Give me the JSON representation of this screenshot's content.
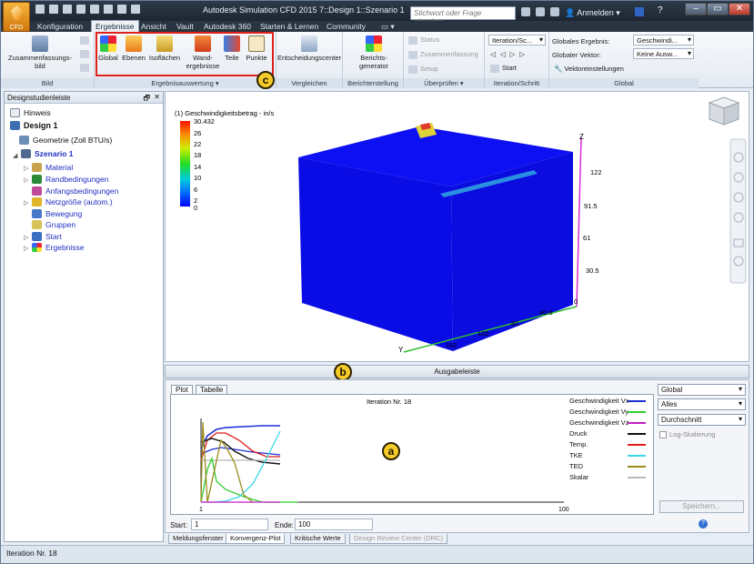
{
  "titlebar": {
    "app_label": "CFD",
    "title": "Autodesk Simulation CFD 2015   7::Design 1::Szenario 1",
    "search_placeholder": "Stichwort oder Frage eingeben",
    "signin": "Anmelden",
    "help": "?"
  },
  "tabs": [
    "Konfiguration",
    "Ergebnisse",
    "Ansicht",
    "Vault",
    "Autodesk 360",
    "Starten & Lernen",
    "Community"
  ],
  "active_tab": "Ergebnisse",
  "ribbon": {
    "bild": {
      "button": "Zusammenfassungs-bild",
      "footer": "Bild"
    },
    "ergebnisauswertung": {
      "buttons": [
        "Global",
        "Ebenen",
        "Isoflächen",
        "Wand-ergebnisse",
        "Teile",
        "Punkte"
      ],
      "footer": "Ergebnisauswertung"
    },
    "vergleichen": {
      "button": "Entscheidungscenter",
      "footer": "Vergleichen"
    },
    "berichterstellung": {
      "button": "Berichts-generator",
      "footer": "Berichterstellung"
    },
    "ueberpruefen": {
      "items": [
        "Status",
        "Zusammenfassung",
        "Setup"
      ],
      "footer": "Überprüfen"
    },
    "iteration": {
      "dropdown": "Iteration/Sc...",
      "start": "Start",
      "footer": "Iteration/Schritt"
    },
    "global": {
      "ergebnis_label": "Globales Ergebnis:",
      "ergebnis_value": "Geschwindi...",
      "vektor_label": "Globaler Vektor:",
      "vektor_value": "Keine Ausw...",
      "vektoreinstellungen": "Vektoreinstellungen",
      "footer": "Global"
    }
  },
  "callouts": {
    "a": "a",
    "b": "b",
    "c": "c"
  },
  "sidebar": {
    "title": "Designstudienleiste",
    "items": [
      {
        "label": "Hinweis"
      },
      {
        "label": "Design 1"
      },
      {
        "label": "Geometrie (Zoll BTU/s)"
      },
      {
        "label": "Szenario 1"
      },
      {
        "label": "Material"
      },
      {
        "label": "Randbedingungen"
      },
      {
        "label": "Anfangsbedingungen"
      },
      {
        "label": "Netzgröße (autom.)"
      },
      {
        "label": "Bewegung"
      },
      {
        "label": "Gruppen"
      },
      {
        "label": "Start"
      },
      {
        "label": "Ergebnisse"
      }
    ]
  },
  "viewport": {
    "legend_title": "(1) Geschwindigkeitsbetrag - in/s",
    "legend_ticks": [
      "30.432",
      "26",
      "22",
      "18",
      "14",
      "10",
      "6",
      "2",
      "0"
    ],
    "axis_z": "Z",
    "axis_y": "Y",
    "z_ticks": [
      "122",
      "91.5",
      "61",
      "30.5",
      "0"
    ],
    "y_ticks": [
      "40.5",
      "81",
      "122",
      "162"
    ]
  },
  "output": {
    "header": "Ausgabeleiste",
    "tabs": [
      "Plot",
      "Tabelle"
    ],
    "plot_title": "Iteration Nr. 18",
    "x_start": "1",
    "x_end": "100",
    "legend": [
      {
        "name": "Geschwindigkeit Vx",
        "color": "#1d2fd6"
      },
      {
        "name": "Geschwindigkeit Vy",
        "color": "#2fcf2f"
      },
      {
        "name": "Geschwindigkeit Vz",
        "color": "#c21fc2"
      },
      {
        "name": "Druck",
        "color": "#111111"
      },
      {
        "name": "Temp.",
        "color": "#e01a1a"
      },
      {
        "name": "TKE",
        "color": "#38d6e8"
      },
      {
        "name": "TED",
        "color": "#9a8a1a"
      },
      {
        "name": "Skalar",
        "color": "#b8b8b8"
      }
    ],
    "selects": [
      "Global",
      "Alles",
      "Durchschnitt"
    ],
    "log_label": "Log-Skalierung",
    "save": "Speichern...",
    "start_label": "Start:",
    "start_value": "1",
    "end_label": "Ende:",
    "end_value": "100"
  },
  "bottom_tabs": [
    "Meldungsfenster",
    "Konvergenz-Plot",
    "Kritische Werte",
    "Design Review Center (DRC)"
  ],
  "status": "Iteration Nr. 18"
}
